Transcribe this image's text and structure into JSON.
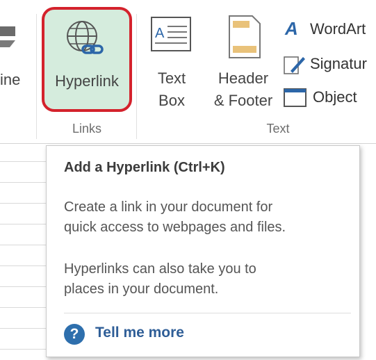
{
  "ribbon": {
    "cut_label": "ine",
    "hyperlink_label": "Hyperlink",
    "textbox_line1": "Text",
    "textbox_line2": "Box",
    "header_line1": "Header",
    "header_line2": "& Footer",
    "wordart_label": "WordArt",
    "signature_label": "Signatur",
    "object_label": "Object",
    "group_links": "Links",
    "group_text": "Text"
  },
  "tooltip": {
    "title": "Add a Hyperlink (Ctrl+K)",
    "body1_line1": "Create a link in your document for",
    "body1_line2": "quick access to webpages and files.",
    "body2_line1": "Hyperlinks can also take you to",
    "body2_line2": "places in your document.",
    "more_label": "Tell me more"
  },
  "colors": {
    "highlight_fill": "#d5ecdd",
    "highlight_border": "#d4222c",
    "link_blue": "#2f5e97"
  }
}
